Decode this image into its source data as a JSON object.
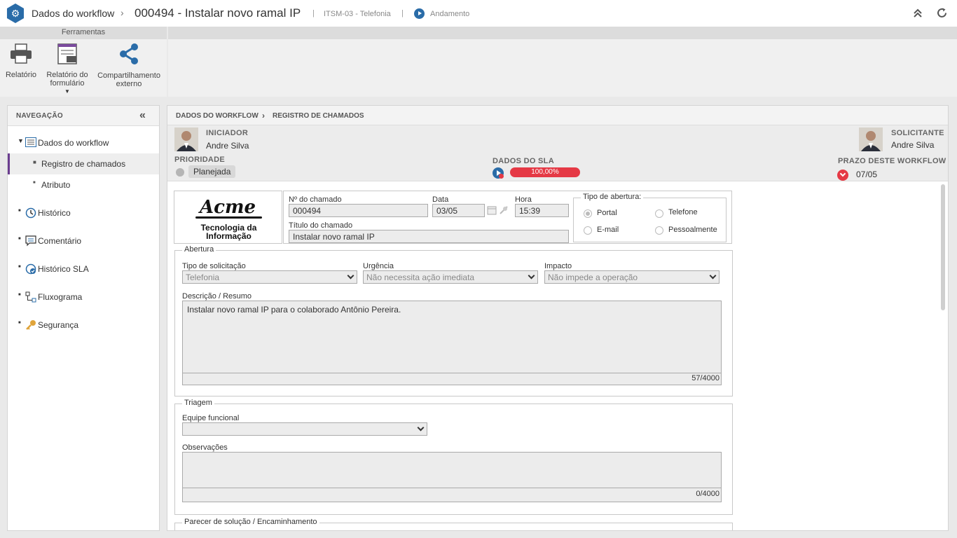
{
  "header": {
    "breadcrumb_root": "Dados do workflow",
    "title": "000494 - Instalar novo ramal IP",
    "process": "ITSM-03 - Telefonia",
    "status": "Andamento"
  },
  "toolbar": {
    "group_label": "Ferramentas",
    "report": "Relatório",
    "form_report_line1": "Relatório do",
    "form_report_line2": "formulário",
    "share_line1": "Compartilhamento",
    "share_line2": "externo"
  },
  "nav": {
    "title": "NAVEGAÇÃO",
    "items": [
      {
        "label": "Dados do workflow",
        "icon": "form-icon"
      },
      {
        "label": "Registro de chamados"
      },
      {
        "label": "Atributo"
      },
      {
        "label": "Histórico",
        "icon": "history-icon"
      },
      {
        "label": "Comentário",
        "icon": "comment-icon"
      },
      {
        "label": "Histórico SLA",
        "icon": "sla-history-icon"
      },
      {
        "label": "Fluxograma",
        "icon": "flowchart-icon"
      },
      {
        "label": "Segurança",
        "icon": "key-icon"
      }
    ]
  },
  "main": {
    "breadcrumb": [
      "DADOS DO WORKFLOW",
      "REGISTRO DE CHAMADOS"
    ],
    "initiator_label": "INICIADOR",
    "initiator_name": "Andre Silva",
    "requester_label": "SOLICITANTE",
    "requester_name": "Andre Silva",
    "priority_label": "PRIORIDADE",
    "priority_value": "Planejada",
    "sla_label": "DADOS DO SLA",
    "sla_percent": "100,00%",
    "deadline_label": "PRAZO DESTE WORKFLOW",
    "deadline_value": "07/05",
    "colors": {
      "accent": "#2a6ca8",
      "sla_bar": "#e53945",
      "deadline_icon": "#e53945"
    }
  },
  "form": {
    "logo_brand": "Acme",
    "logo_line1": "Tecnologia da",
    "logo_line2": "Informação",
    "call_number_label": "Nº do chamado",
    "call_number": "000494",
    "date_label": "Data",
    "date": "03/05",
    "time_label": "Hora",
    "time": "15:39",
    "call_title_label": "Título do chamado",
    "call_title": "Instalar novo ramal IP",
    "opening_type_label": "Tipo de abertura:",
    "opening_types": [
      {
        "label": "Portal",
        "checked": true
      },
      {
        "label": "Telefone",
        "checked": false
      },
      {
        "label": "E-mail",
        "checked": false
      },
      {
        "label": "Pessoalmente",
        "checked": false
      }
    ],
    "abertura_legend": "Abertura",
    "request_type_label": "Tipo de solicitação",
    "request_type": "Telefonia",
    "urgency_label": "Urgência",
    "urgency": "Não necessita ação imediata",
    "impact_label": "Impacto",
    "impact": "Não impede a operação",
    "description_label": "Descrição / Resumo",
    "description": "Instalar novo ramal IP para o colaborado Antônio Pereira.",
    "description_count": "57/4000",
    "triagem_legend": "Triagem",
    "team_label": "Equipe funcional",
    "team": "",
    "notes_label": "Observações",
    "notes": "",
    "notes_count": "0/4000",
    "solution_legend": "Parecer de solução / Encaminhamento"
  }
}
